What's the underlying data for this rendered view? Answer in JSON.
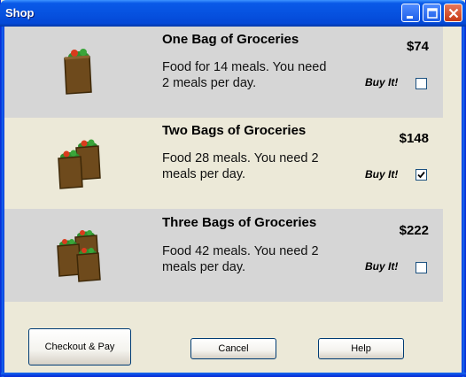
{
  "window": {
    "title": "Shop"
  },
  "items": [
    {
      "name": "One Bag of Groceries",
      "price": "$74",
      "description": "Food for 14 meals. You need 2 meals per day.",
      "buy_label": "Buy It!",
      "checked": false,
      "bag_count": 1
    },
    {
      "name": "Two Bags of Groceries",
      "price": "$148",
      "description": "Food 28 meals. You need 2 meals per day.",
      "buy_label": "Buy It!",
      "checked": true,
      "bag_count": 2
    },
    {
      "name": "Three Bags of Groceries",
      "price": "$222",
      "description": "Food 42 meals. You need 2 meals per day.",
      "buy_label": "Buy It!",
      "checked": false,
      "bag_count": 3
    }
  ],
  "buttons": {
    "checkout": "Checkout & Pay",
    "cancel": "Cancel",
    "help": "Help"
  },
  "colors": {
    "titlebar": "#0a5ae8",
    "row_shade": "#d6d6d6",
    "window_bg": "#ece9d8",
    "bag_brown": "#6e4a1c"
  }
}
